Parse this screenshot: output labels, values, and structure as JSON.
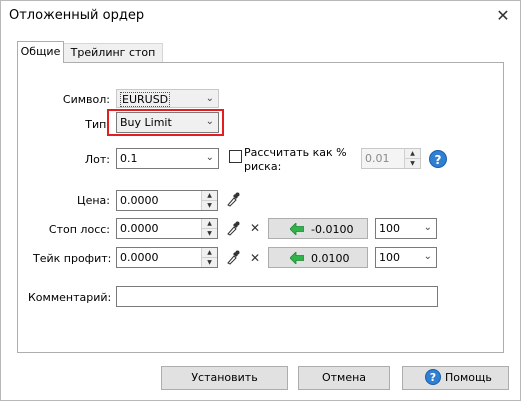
{
  "window": {
    "title": "Отложенный ордер",
    "close_glyph": "✕"
  },
  "tabs": [
    {
      "label": "Общие",
      "active": true
    },
    {
      "label": "Трейлинг стоп",
      "active": false
    }
  ],
  "form": {
    "symbol": {
      "label": "Символ:",
      "value": "EURUSD"
    },
    "type": {
      "label": "Тип:",
      "value": "Buy Limit"
    },
    "lot": {
      "label": "Лот:",
      "value": "0.1"
    },
    "risk": {
      "checkbox_label_line1": "Рассчитать как %",
      "checkbox_label_line2": "риска:",
      "value": "0.01",
      "checked": false
    },
    "price": {
      "label": "Цена:",
      "value": "0.0000"
    },
    "stop_loss": {
      "label": "Стоп лосс:",
      "value": "0.0000",
      "offset": "-0.0100",
      "points": "100"
    },
    "take_profit": {
      "label": "Тейк профит:",
      "value": "0.0000",
      "offset": "0.0100",
      "points": "100"
    },
    "comment": {
      "label": "Комментарий:",
      "value": ""
    }
  },
  "buttons": {
    "set": "Установить",
    "cancel": "Отмена",
    "help": "Помощь"
  },
  "icons": {
    "help": "?",
    "chevron": "⌄",
    "spin_up": "▲",
    "spin_down": "▼",
    "clear": "✕"
  },
  "colors": {
    "highlight": "#e41e1e",
    "arrow_green": "#2fb34a",
    "help_blue": "#2f7fd3"
  }
}
